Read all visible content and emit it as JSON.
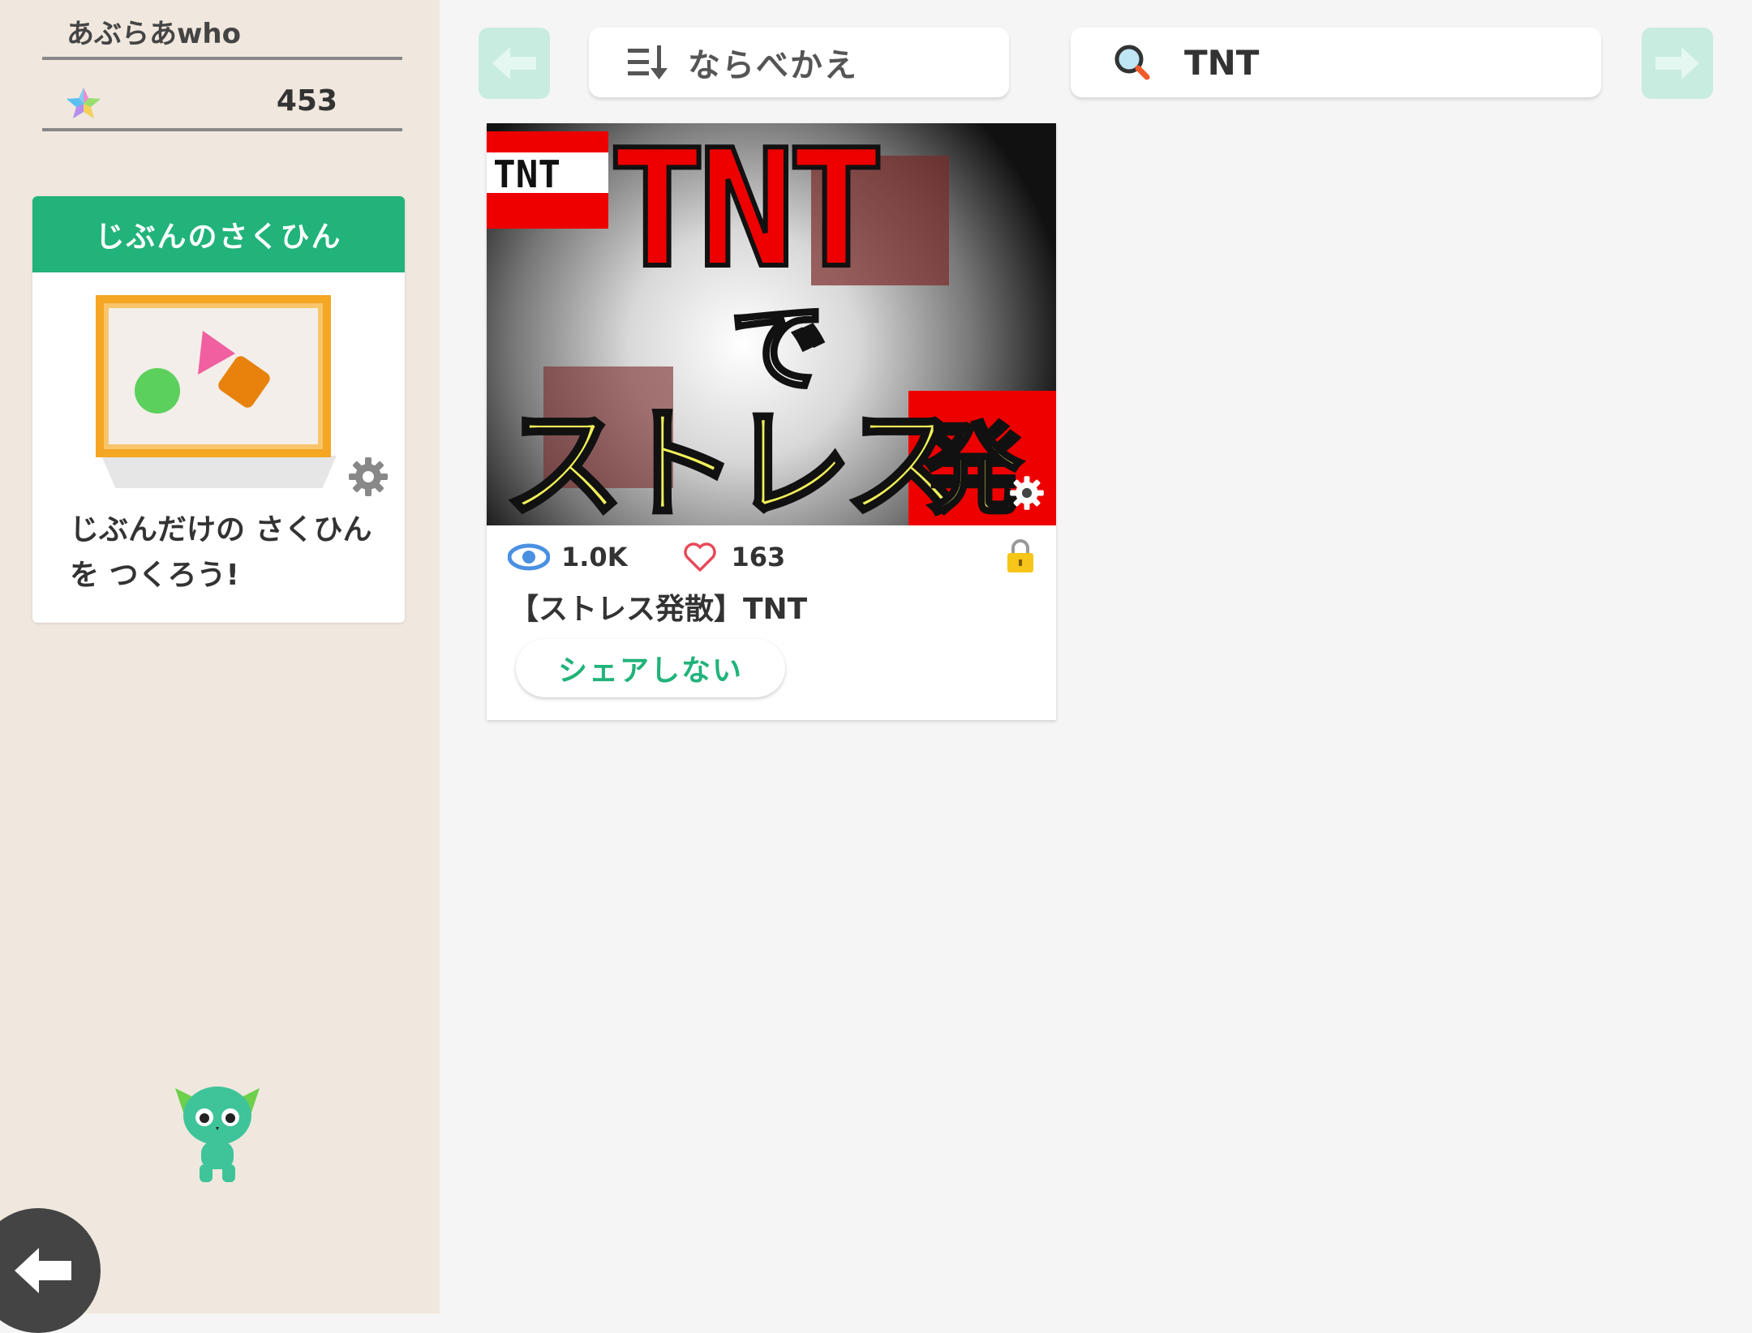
{
  "user": {
    "name": "あぶらあwho",
    "points": "453"
  },
  "my_works": {
    "header": "じぶんのさくひん",
    "prompt": "じぶんだけの さくひんを つくろう!"
  },
  "toolbar": {
    "sort_label": "ならべかえ",
    "search_value": "TNT"
  },
  "works": [
    {
      "title": "【ストレス発散】TNT",
      "views": "1.0K",
      "likes": "163",
      "share_label": "シェアしない"
    }
  ],
  "colors": {
    "accent": "#21b37a",
    "sidebar_bg": "#f0e8de",
    "nav_disabled": "#c8ece0"
  }
}
